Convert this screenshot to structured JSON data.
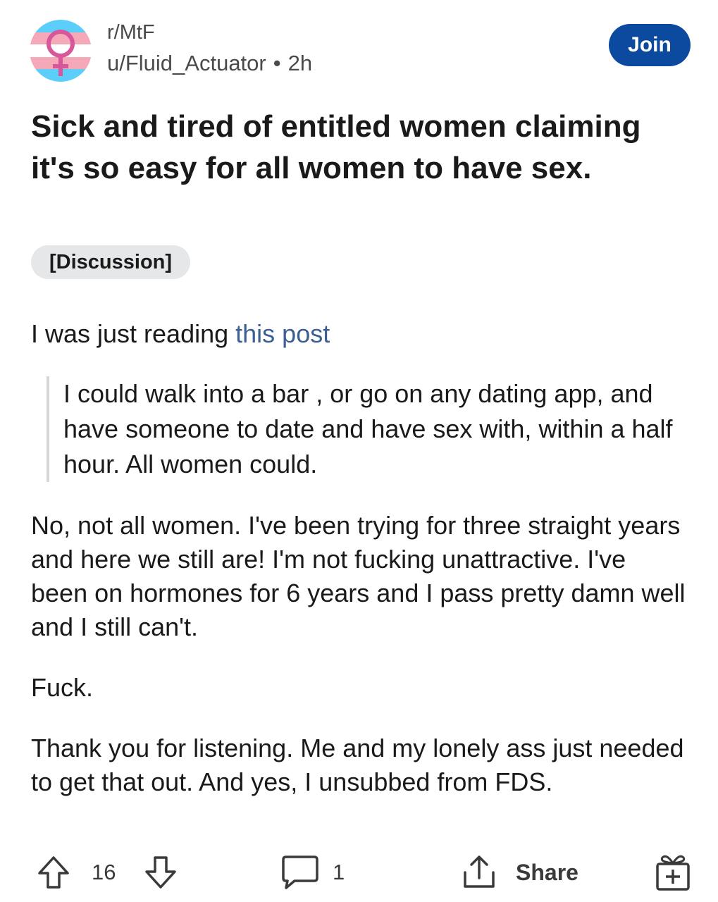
{
  "header": {
    "subreddit": "r/MtF",
    "username": "u/Fluid_Actuator",
    "separator": "•",
    "time_ago": "2h",
    "join_label": "Join",
    "avatar_icon": "female-symbol-icon",
    "flag_colors": [
      "#5bcefa",
      "#f5a9b8",
      "#ffffff",
      "#f5a9b8",
      "#5bcefa"
    ]
  },
  "post": {
    "title": "Sick and tired of entitled women claiming it's so easy for all women to have sex.",
    "flair": "[Discussion]",
    "intro_text": "I was just reading ",
    "intro_link": "this post",
    "quote": "I could walk into a bar , or go on any dating app, and have someone to date and have sex with, within a half hour. All women could.",
    "paragraph_2": "No, not all women. I've been trying for three straight years and here we still are! I'm not fucking unattractive. I've been on hormones for 6 years and I pass pretty damn well and I still can't.",
    "paragraph_3": "Fuck.",
    "paragraph_4": "Thank you for listening. Me and my lonely ass just needed to get that out. And yes, I unsubbed from FDS."
  },
  "actions": {
    "vote_count": "16",
    "comment_count": "1",
    "share_label": "Share",
    "icons": [
      "upvote-icon",
      "downvote-icon",
      "comment-icon",
      "share-icon",
      "award-icon"
    ]
  },
  "colors": {
    "join_button": "#0b4a9e",
    "link": "#3b5f91",
    "flair_bg": "#e6e7e8"
  }
}
